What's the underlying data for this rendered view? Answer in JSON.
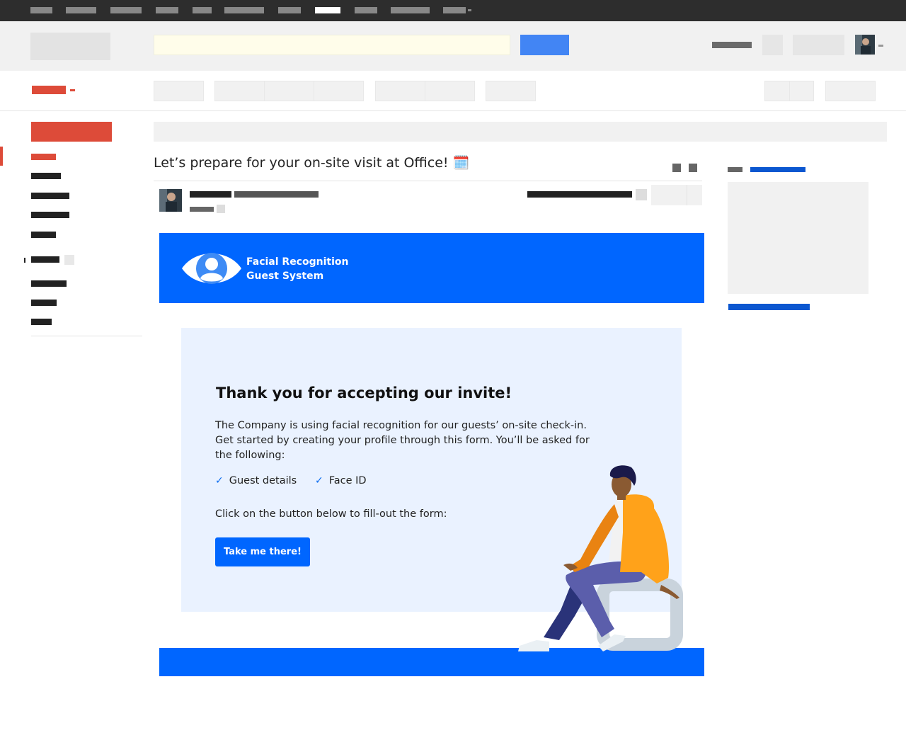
{
  "email": {
    "subject": "Let’s prepare for your on-site visit at Office! 🗓️"
  },
  "banner": {
    "title_line1": "Facial Recognition",
    "title_line2": "Guest System",
    "logo_icon": "eye-person-icon"
  },
  "card": {
    "heading": "Thank you for accepting our invite!",
    "body": "The Company is using facial recognition for our guests’ on-site check-in. Get started by creating your profile through this form. You’ll be asked for the following:",
    "checklist": [
      {
        "label": "Guest details",
        "icon": "checkmark-icon"
      },
      {
        "label": "Face ID",
        "icon": "checkmark-icon"
      }
    ],
    "cta_text": "Click on the button below to fill-out the form:",
    "cta_button": "Take me there!"
  },
  "colors": {
    "brand_blue": "#0066ff",
    "card_bg": "#eaf2ff",
    "mail_red": "#dd4b39",
    "search_button": "#4285f4",
    "sidebar_link_blue": "#0b57d0"
  }
}
